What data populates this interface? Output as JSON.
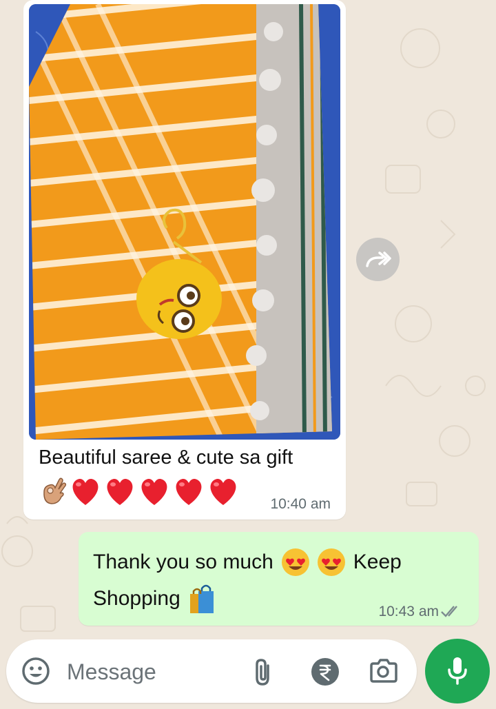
{
  "chat": {
    "incoming": {
      "caption": "Beautiful saree & cute sa gift",
      "emojis": [
        "ok-hand-emoji",
        "red-heart-emoji",
        "red-heart-emoji",
        "red-heart-emoji",
        "red-heart-emoji",
        "red-heart-emoji"
      ],
      "time": "10:40 am"
    },
    "outgoing": {
      "line1_before": "Thank you so much",
      "line1_after": "Keep",
      "line2": "Shopping",
      "time": "10:43 am",
      "status": "delivered"
    }
  },
  "input": {
    "placeholder": "Message"
  },
  "icons": {
    "emoji": "smiley-icon",
    "attach": "paperclip-icon",
    "payment": "rupee-icon",
    "camera": "camera-icon",
    "mic": "microphone-icon",
    "forward": "forward-icon"
  },
  "colors": {
    "background": "#efe7dc",
    "incoming_bubble": "#ffffff",
    "outgoing_bubble": "#d8fdd2",
    "accent": "#1fa855"
  }
}
